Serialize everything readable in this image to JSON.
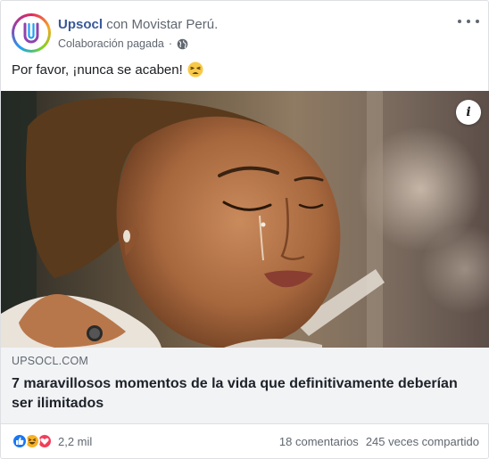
{
  "post": {
    "page_name": "Upsocl",
    "with_text": "con",
    "partner_name": "Movistar Perú.",
    "sponsored_label": "Colaboración pagada",
    "separator": "·",
    "audience_icon": "globe-icon",
    "message": "Por favor, ¡nunca se acaben!",
    "message_emoji": "tired-face-emoji"
  },
  "link": {
    "domain": "UPSOCL.COM",
    "title": "7 maravillosos momentos de la vida que definitivamente deberían ser ilimitados"
  },
  "footer": {
    "reaction_icons": [
      "like-icon",
      "haha-icon",
      "love-icon"
    ],
    "reaction_count": "2,2 mil",
    "comments": "18 comentarios",
    "shares": "245 veces compartido"
  },
  "colors": {
    "page_name": "#385898",
    "secondary_text": "#606770",
    "link_box_bg": "#f2f3f5",
    "like": "#1877f2",
    "haha": "#f7b125",
    "love": "#f33e58"
  }
}
